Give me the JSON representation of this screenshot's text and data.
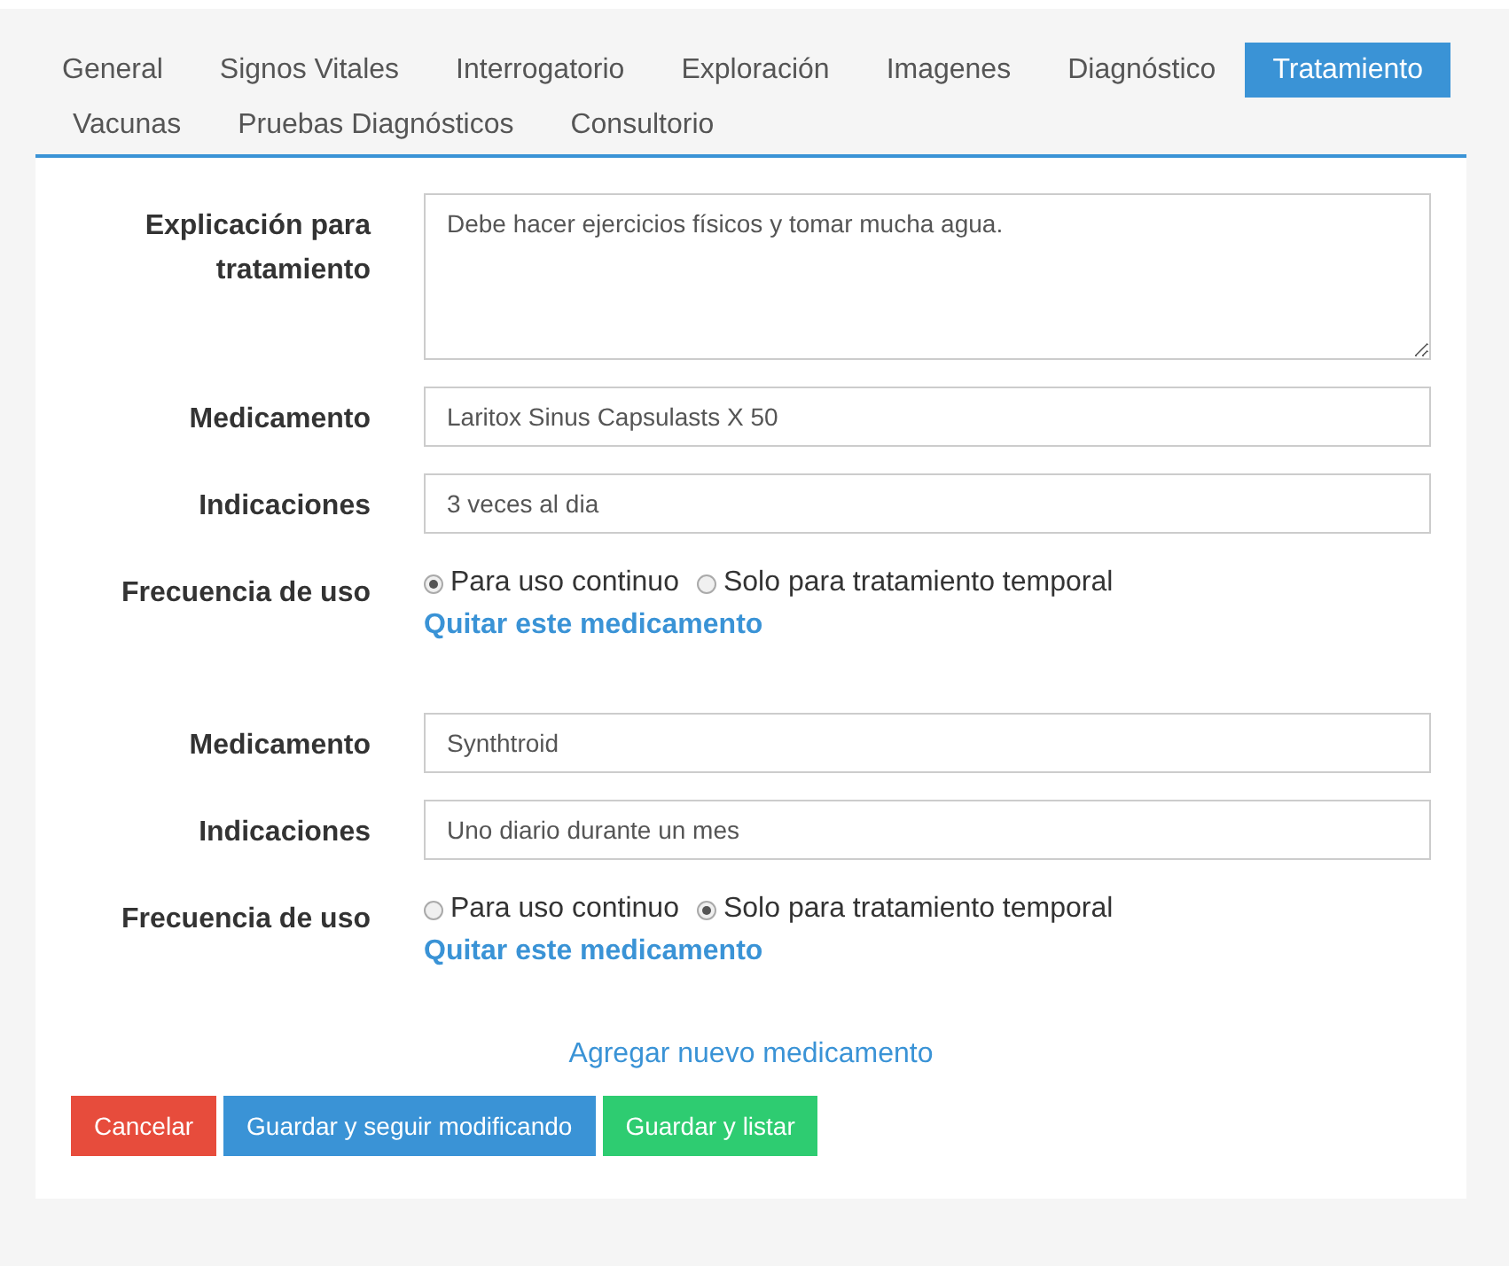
{
  "tabs": [
    {
      "label": "General",
      "selected": false
    },
    {
      "label": "Signos Vitales",
      "selected": false
    },
    {
      "label": "Interrogatorio",
      "selected": false
    },
    {
      "label": "Exploración",
      "selected": false
    },
    {
      "label": "Imagenes",
      "selected": false
    },
    {
      "label": "Diagnóstico",
      "selected": false
    },
    {
      "label": "Tratamiento",
      "selected": true
    },
    {
      "label": "Vacunas",
      "selected": false
    },
    {
      "label": "Pruebas Diagnósticos",
      "selected": false
    },
    {
      "label": "Consultorio",
      "selected": false
    }
  ],
  "explanation": {
    "label": "Explicación para tratamiento",
    "value": "Debe hacer ejercicios físicos y tomar mucha agua."
  },
  "medications": [
    {
      "medication_label": "Medicamento",
      "medication": "Laritox Sinus Capsulasts X 50",
      "indications_label": "Indicaciones",
      "indications": "3 veces al dia",
      "frequency_label": "Frecuencia de uso",
      "options": [
        {
          "label": "Para uso continuo",
          "selected": true
        },
        {
          "label": "Solo para tratamiento temporal",
          "selected": false
        }
      ],
      "remove_link": "Quitar este medicamento"
    },
    {
      "medication_label": "Medicamento",
      "medication": "Synthtroid",
      "indications_label": "Indicaciones",
      "indications": "Uno diario durante un mes",
      "frequency_label": "Frecuencia de uso",
      "options": [
        {
          "label": "Para uso continuo",
          "selected": false
        },
        {
          "label": "Solo para tratamiento temporal",
          "selected": true
        }
      ],
      "remove_link": "Quitar este medicamento"
    }
  ],
  "add_link": "Agregar nuevo medicamento",
  "buttons": [
    {
      "label": "Cancelar",
      "kind": "danger"
    },
    {
      "label": "Guardar y seguir modificando",
      "kind": "primary"
    },
    {
      "label": "Guardar y listar",
      "kind": "success"
    }
  ]
}
